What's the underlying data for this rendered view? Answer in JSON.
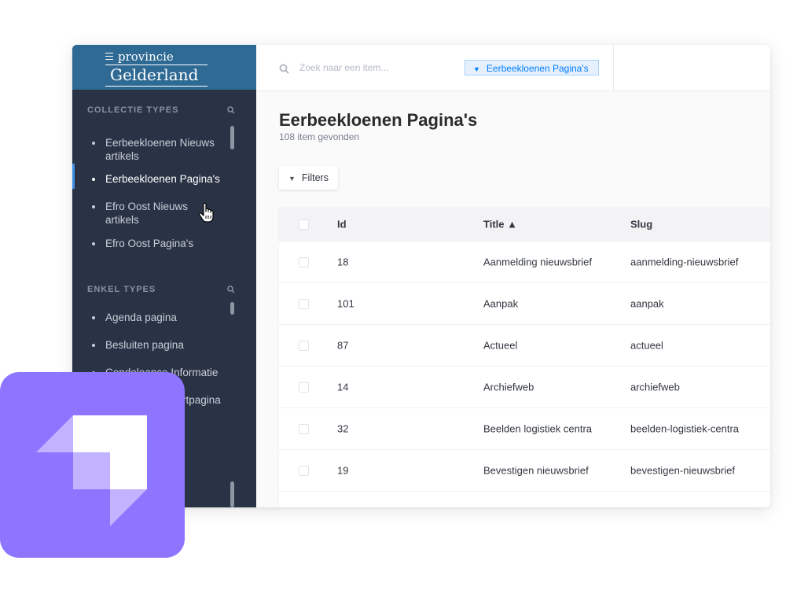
{
  "brand": {
    "line1": "provincie",
    "line2": "Gelderland"
  },
  "sidebar": {
    "collection_header": "COLLECTIE TYPES",
    "collection_items": [
      {
        "label": "Eerbeekloenen Nieuws artikels"
      },
      {
        "label": "Eerbeekloenen Pagina's",
        "active": true
      },
      {
        "label": "Efro Oost Nieuws artikels"
      },
      {
        "label": "Efro Oost Pagina's"
      }
    ],
    "single_header": "ENKEL TYPES",
    "single_items": [
      {
        "label": "Agenda pagina"
      },
      {
        "label": "Besluiten pagina"
      },
      {
        "label": "Condoleance Informatie"
      },
      {
        "label": "rtpagina"
      }
    ]
  },
  "topbar": {
    "search_placeholder": "Zoek naar een item...",
    "active_tag": "Eerbeekloenen Pagina's"
  },
  "main": {
    "title": "Eerbeekloenen Pagina's",
    "count": "108 item gevonden",
    "filters_label": "Filters"
  },
  "table": {
    "columns": [
      "Id",
      "Title ▲",
      "Slug"
    ],
    "rows": [
      {
        "id": "18",
        "title": "Aanmelding nieuwsbrief",
        "slug": "aanmelding-nieuwsbrief"
      },
      {
        "id": "101",
        "title": "Aanpak",
        "slug": "aanpak"
      },
      {
        "id": "87",
        "title": "Actueel",
        "slug": "actueel"
      },
      {
        "id": "14",
        "title": "Archiefweb",
        "slug": "archiefweb"
      },
      {
        "id": "32",
        "title": "Beelden logistiek centra",
        "slug": "beelden-logistiek-centra"
      },
      {
        "id": "19",
        "title": "Bevestigen nieuwsbrief",
        "slug": "bevestigen-nieuwsbrief"
      }
    ]
  },
  "colors": {
    "sidebar": "#2a3345",
    "brand": "#2f6a94",
    "accent": "#007eff",
    "logo": "#8e75ff"
  },
  "icons": [
    "menu-icon",
    "search-icon",
    "filter-icon",
    "hand-cursor-icon",
    "strapi-logo"
  ]
}
